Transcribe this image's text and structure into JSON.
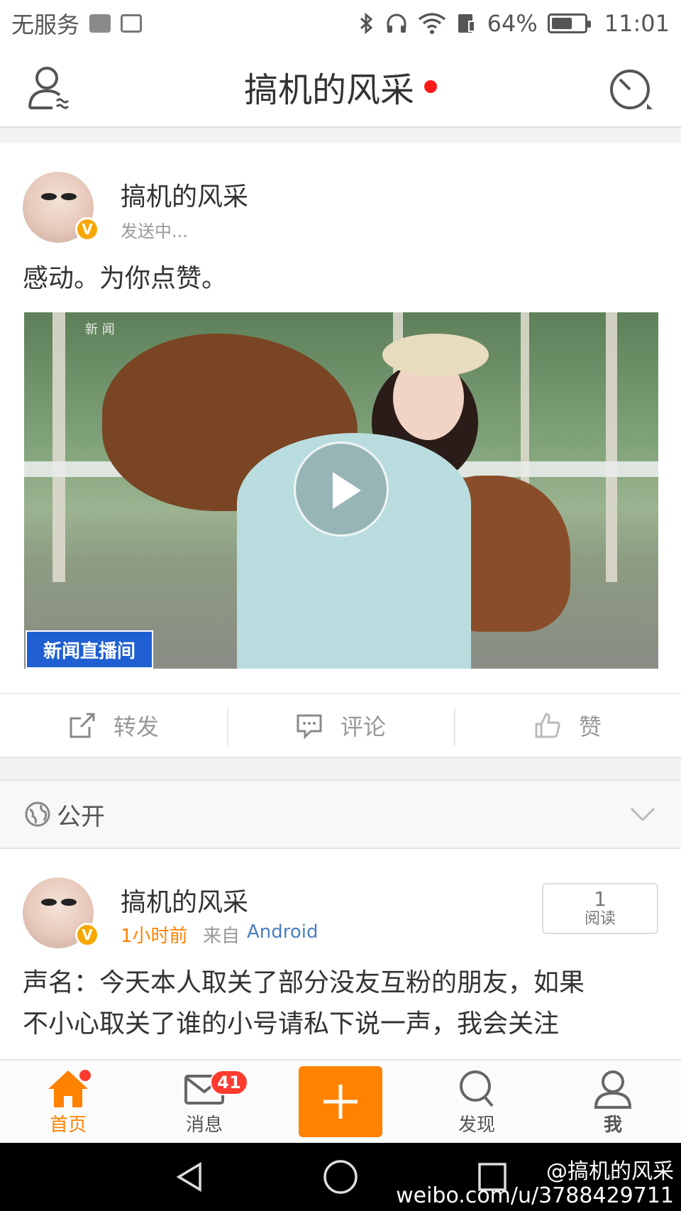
{
  "status_bar": {
    "carrier": "无服务",
    "battery": "64%",
    "battery_level": 0.64,
    "time": "11:01"
  },
  "nav": {
    "title": "搞机的风采"
  },
  "post1": {
    "user_name": "搞机的风采",
    "status": "发送中...",
    "text": "感动。为你点赞。",
    "video": {
      "corner_small_text": "新 闻",
      "caption_tag": "新闻直播间"
    }
  },
  "actions": {
    "repost": "转发",
    "comment": "评论",
    "like": "赞"
  },
  "visibility": {
    "label": "公开"
  },
  "post2": {
    "user_name": "搞机的风采",
    "time": "1小时前",
    "source_prefix": "来自",
    "source": "Android",
    "read_count": "1",
    "read_label": "阅读",
    "text_line1": "声名：今天本人取关了部分没友互粉的朋友，如果",
    "text_line2": "不小心取关了谁的小号请私下说一声，我会关注"
  },
  "tab_bar": {
    "home": "首页",
    "messages": "消息",
    "messages_badge": "41",
    "discover": "发现",
    "me": "我"
  },
  "watermark": {
    "handle": "@搞机的风采",
    "url": "weibo.com/u/3788429711"
  },
  "colors": {
    "accent": "#ff8200",
    "badge_red": "#ff3b30",
    "link_blue": "#4a7fc0",
    "time_orange": "#ff8200"
  }
}
